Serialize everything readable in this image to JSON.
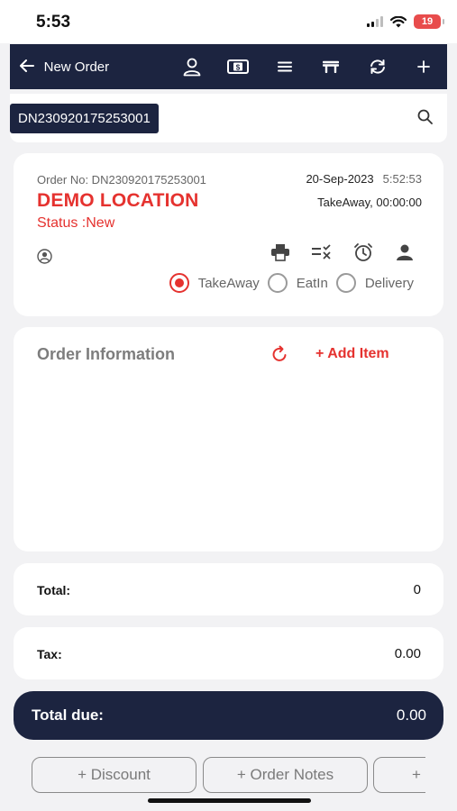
{
  "status_bar": {
    "time": "5:53",
    "battery": "19"
  },
  "toolbar": {
    "title": "New Order",
    "icons": [
      "back-arrow-icon",
      "customer-icon",
      "cash-icon",
      "menu-icon",
      "table-icon",
      "sync-icon",
      "plus-icon"
    ]
  },
  "search": {
    "order_id": "DN230920175253001"
  },
  "order": {
    "order_no_label": "Order No: DN230920175253001",
    "date": "20-Sep-2023",
    "time": "5:52:53",
    "location": "DEMO LOCATION",
    "mode_time": "TakeAway, 00:00:00",
    "status": "Status :New",
    "types": [
      {
        "label": "TakeAway",
        "selected": true
      },
      {
        "label": "EatIn",
        "selected": false
      },
      {
        "label": "Delivery",
        "selected": false
      }
    ]
  },
  "order_info": {
    "title": "Order Information",
    "add_item": "+ Add Item"
  },
  "totals": {
    "total_label": "Total:",
    "total_value": "0",
    "tax_label": "Tax:",
    "tax_value": "0.00",
    "due_label": "Total due:",
    "due_value": "0.00"
  },
  "actions": {
    "discount": "+ Discount",
    "notes": "+ Order Notes",
    "more": "+"
  },
  "colors": {
    "navy": "#1c2440",
    "accent_red": "#e5322f"
  }
}
